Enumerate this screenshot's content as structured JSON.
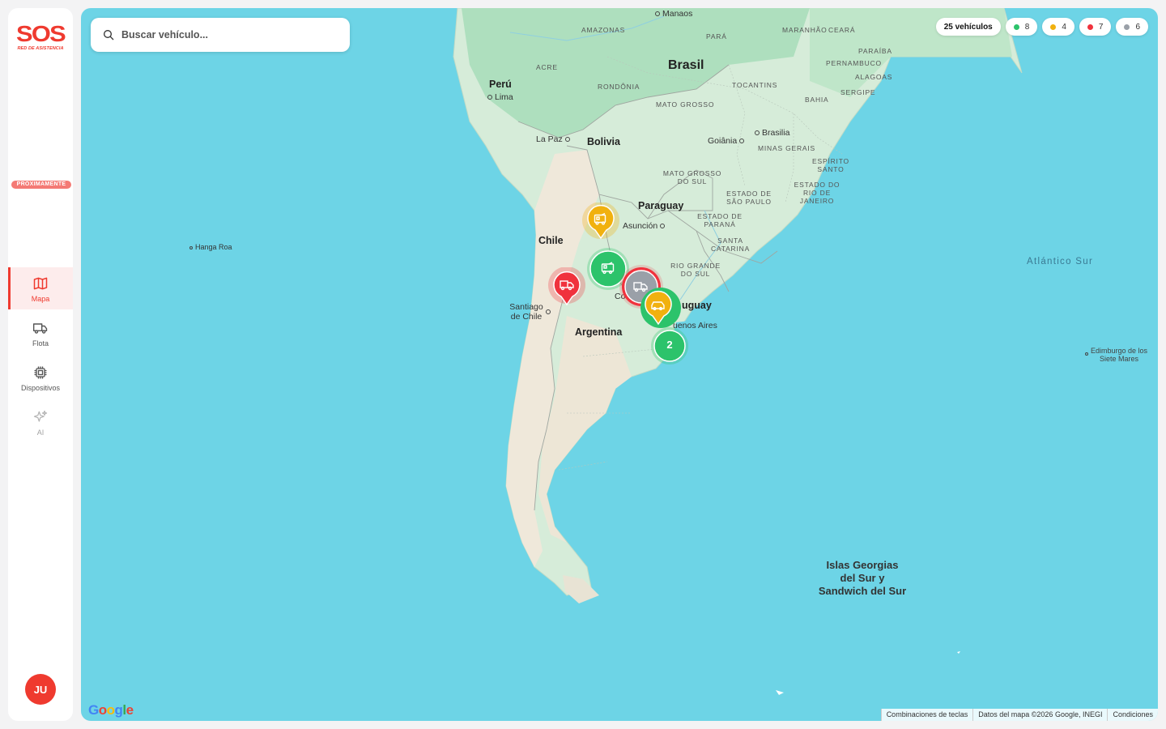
{
  "brand": {
    "logo_text": "SOS",
    "logo_subtitle": "RED DE ASISTENCIA",
    "accent": "#ef3a2f"
  },
  "search": {
    "placeholder": "Buscar vehículo..."
  },
  "nav": [
    {
      "label": "Mapa",
      "icon": "map-icon",
      "active": true
    },
    {
      "label": "Flota",
      "icon": "truck-icon",
      "active": false
    },
    {
      "label": "Dispositivos",
      "icon": "chip-icon",
      "active": false
    },
    {
      "label": "AI",
      "icon": "sparkles-icon",
      "active": false,
      "badge": "PRÓXIMAMENTE"
    }
  ],
  "user": {
    "initials": "JU"
  },
  "stats": {
    "total": "25 vehículos",
    "green": {
      "count": "8",
      "color": "#2cc36b"
    },
    "yellow": {
      "count": "4",
      "color": "#f1b10f"
    },
    "red": {
      "count": "7",
      "color": "#f0323d"
    },
    "gray": {
      "count": "6",
      "color": "#9aa0a8"
    }
  },
  "map_labels": {
    "countries": {
      "brasil": "Brasil",
      "peru": "Perú",
      "bolivia": "Bolivia",
      "paraguay": "Paraguay",
      "chile": "Chile",
      "argentina": "Argentina",
      "uruguay": "uguay"
    },
    "states": {
      "amazonas": "AMAZONAS",
      "para": "PARÁ",
      "maranhao": "MARANHÃO",
      "ceara": "CEARÁ",
      "paraiba": "PARAÍBA",
      "pernambuco": "PERNAMBUCO",
      "alagoas": "ALAGOAS",
      "sergipe": "SERGIPE",
      "bahia": "BAHIA",
      "acre": "ACRE",
      "rondonia": "RONDÔNIA",
      "mato_grosso": "MATO GROSSO",
      "tocantins": "TOCANTINS",
      "minas_gerais": "MINAS GERAIS",
      "espirito_santo": "ESPÍRITO SANTO",
      "mato_grosso_sul": "MATO GROSSO DO SUL",
      "sao_paulo": "ESTADO DE SÃO PAULO",
      "rio": "ESTADO DO RIO DE JANEIRO",
      "parana": "ESTADO DE PARANÁ",
      "santa_catarina": "SANTA CATARINA",
      "rio_grande_sul": "RIO GRANDE DO SUL"
    },
    "cities": {
      "manaos": "Manaos",
      "lima": "Lima",
      "la_paz": "La Paz",
      "brasilia": "Brasilia",
      "goiania": "Goiânia",
      "asuncion": "Asunción",
      "santiago": "Santiago de Chile",
      "buenos_aires": "uenos Aires",
      "co": "Co",
      "hanga_roa": "Hanga Roa"
    },
    "oceans": {
      "atlantico_sur": "Atlántico Sur"
    },
    "islands": {
      "georgias": "Islas Georgias del Sur y Sandwich del Sur",
      "edimburgo": "Edimburgo de los Siete Mares"
    }
  },
  "markers": [
    {
      "type": "pin",
      "status": "yellow",
      "icon": "camper-icon"
    },
    {
      "type": "cluster",
      "status": "green",
      "icon": "camper-icon"
    },
    {
      "type": "pin",
      "status": "red",
      "icon": "truck-icon"
    },
    {
      "type": "cluster",
      "status": "gray",
      "ring": "red",
      "icon": "truck-icon"
    },
    {
      "type": "pin",
      "status": "yellow",
      "ring": "green",
      "icon": "car-icon"
    },
    {
      "type": "cluster",
      "status": "green",
      "count": "2"
    }
  ],
  "footer": {
    "shortcuts": "Combinaciones de teclas",
    "data": "Datos del mapa ©2026 Google, INEGI",
    "terms": "Condiciones",
    "google": "Google"
  }
}
